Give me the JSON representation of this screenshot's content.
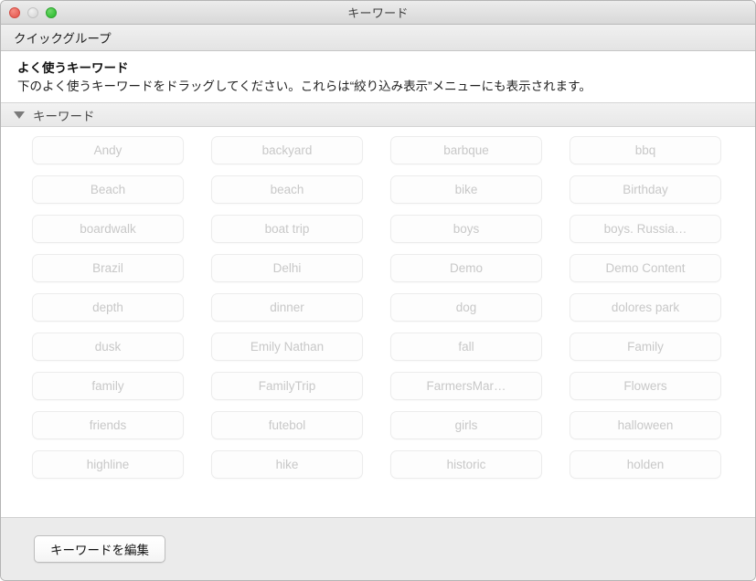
{
  "window": {
    "title": "キーワード",
    "traffic_lights": [
      {
        "name": "close",
        "color": "#e8635a"
      },
      {
        "name": "minimize",
        "color": "#dcdcdc"
      },
      {
        "name": "zoom",
        "color": "#39c13a"
      }
    ]
  },
  "toolbar": {
    "quick_group_label": "クイックグループ"
  },
  "header": {
    "title": "よく使うキーワード",
    "description": "下のよく使うキーワードをドラッグしてください。これらは“絞り込み表示”メニューにも表示されます。"
  },
  "section": {
    "label": "キーワード",
    "disclosure_icon": "triangle-down-icon",
    "expanded": true
  },
  "keywords": [
    "Andy",
    "backyard",
    "barbque",
    "bbq",
    "Beach",
    "beach",
    "bike",
    "Birthday",
    "boardwalk",
    "boat trip",
    "boys",
    "boys. Russia…",
    "Brazil",
    "Delhi",
    "Demo",
    "Demo Content",
    "depth",
    "dinner",
    "dog",
    "dolores park",
    "dusk",
    "Emily Nathan",
    "fall",
    "Family",
    "family",
    "FamilyTrip",
    "FarmersMar…",
    "Flowers",
    "friends",
    "futebol",
    "girls",
    "halloween",
    "highline",
    "hike",
    "historic",
    "holden"
  ],
  "footer": {
    "edit_keywords_label": "キーワードを編集"
  },
  "colors": {
    "titlebar_top": "#ececec",
    "titlebar_bottom": "#d8d8d8",
    "content_bg": "#ffffff",
    "footer_bg": "#ebebeb",
    "keyword_text": "#c8c8c8",
    "keyword_border": "#ececec"
  }
}
